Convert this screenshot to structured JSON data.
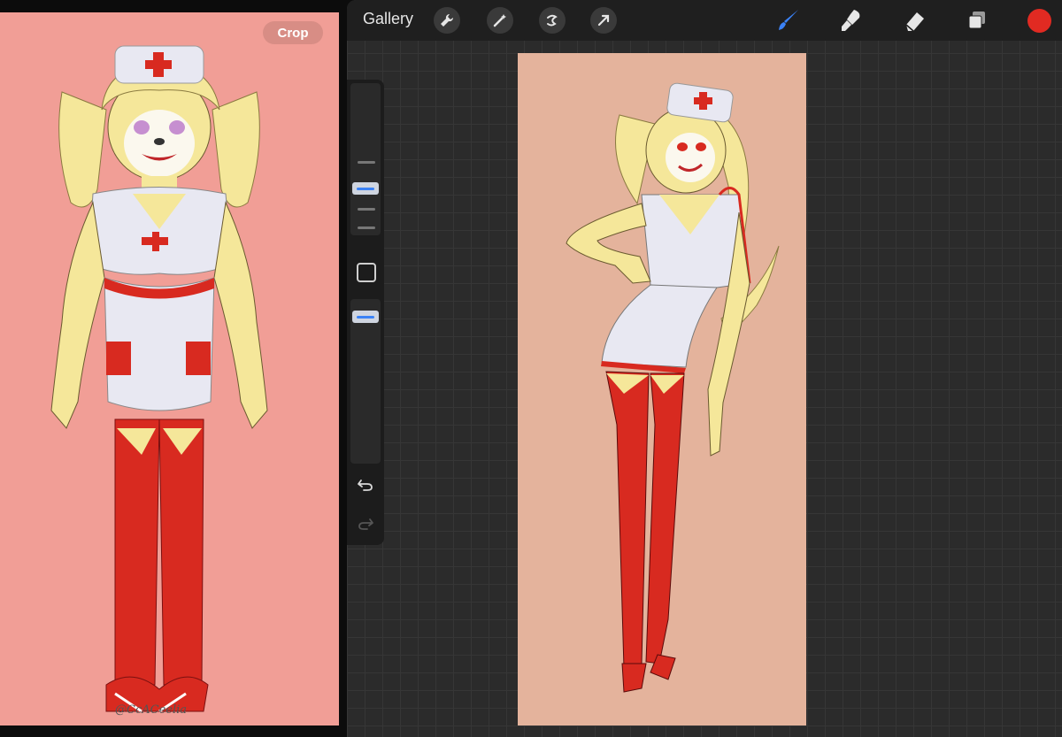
{
  "reference": {
    "crop_label": "Crop",
    "signature": "@CcACeelia"
  },
  "toolbar": {
    "gallery_label": "Gallery",
    "left_tools": [
      "wrench-icon",
      "magic-wand-icon",
      "selection-icon",
      "transform-arrow-icon"
    ],
    "right_tools": [
      "brush-icon",
      "smudge-icon",
      "eraser-icon",
      "layers-icon"
    ],
    "current_color": "#e12a22"
  },
  "colors": {
    "reference_bg": "#f19e96",
    "canvas_bg": "#e4b39c",
    "skin": "#f5e79a",
    "outfit": "#e8e8f2",
    "accent_red": "#d82a20"
  }
}
